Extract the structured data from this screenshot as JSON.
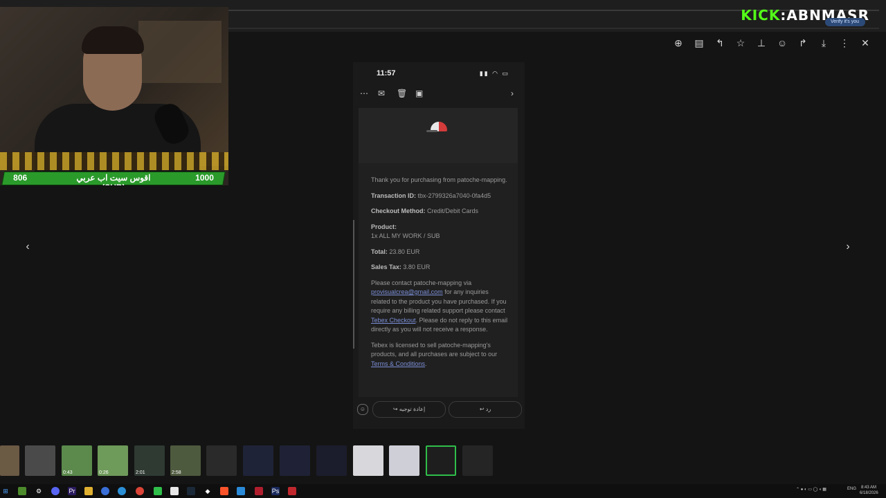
{
  "browser": {
    "kick_prefix": "KICK",
    "kick_sep": ":",
    "channel": "ABNMASR",
    "verify_pill": "Verify it's you"
  },
  "webcam": {
    "left_count": "806",
    "center_label": "اقوس سيت اب عربي (SUB)",
    "right_count": "1000"
  },
  "viewer_toolbar": {
    "icons": [
      "zoom-in-icon",
      "caption-icon",
      "reply-icon",
      "star-icon",
      "pin-icon",
      "emoji-icon",
      "forward-icon",
      "download-icon",
      "more-icon",
      "close-icon"
    ]
  },
  "phone": {
    "time": "11:57",
    "status_icons": "▮▮ ◠ ▭",
    "card": {
      "intro": "Thank you for purchasing from patoche-mapping.",
      "transaction_label": "Transaction ID:",
      "transaction_value": "tbx-2799326a7040-0fa4d5",
      "checkout_label": "Checkout Method:",
      "checkout_value": "Credit/Debit Cards",
      "product_label": "Product:",
      "product_value": "1x ALL MY WORK / SUB",
      "total_label": "Total:",
      "total_value": "23.80 EUR",
      "tax_label": "Sales Tax:",
      "tax_value": "3.80 EUR",
      "contact_1": "Please contact patoche-mapping via",
      "contact_email": "provisualcrea@gmail.com",
      "contact_2": "for any inquiries related to the product you have purchased. If you require any billing related support please contact",
      "contact_link": "Tebex Checkout",
      "contact_3": ". Please do not reply to this email directly as you will not receive a response.",
      "license_1": "Tebex is licensed to sell patoche-mapping's products, and all purchases are subject to our",
      "license_link": "Terms & Conditions",
      "license_2": "."
    },
    "forward_label": "إعادة توجيه",
    "reply_label": "رد"
  },
  "thumbnails": [
    {
      "dur": ""
    },
    {
      "dur": ""
    },
    {
      "dur": "0:43"
    },
    {
      "dur": "0:26"
    },
    {
      "dur": "2:01"
    },
    {
      "dur": "2:58"
    },
    {
      "dur": ""
    },
    {
      "dur": ""
    },
    {
      "dur": ""
    },
    {
      "dur": ""
    },
    {
      "dur": ""
    },
    {
      "dur": ""
    },
    {
      "dur": ""
    },
    {
      "dur": ""
    }
  ],
  "taskbar": {
    "lang": "ENG",
    "clock_time": "8:43 AM",
    "clock_date": "6/18/2026"
  }
}
